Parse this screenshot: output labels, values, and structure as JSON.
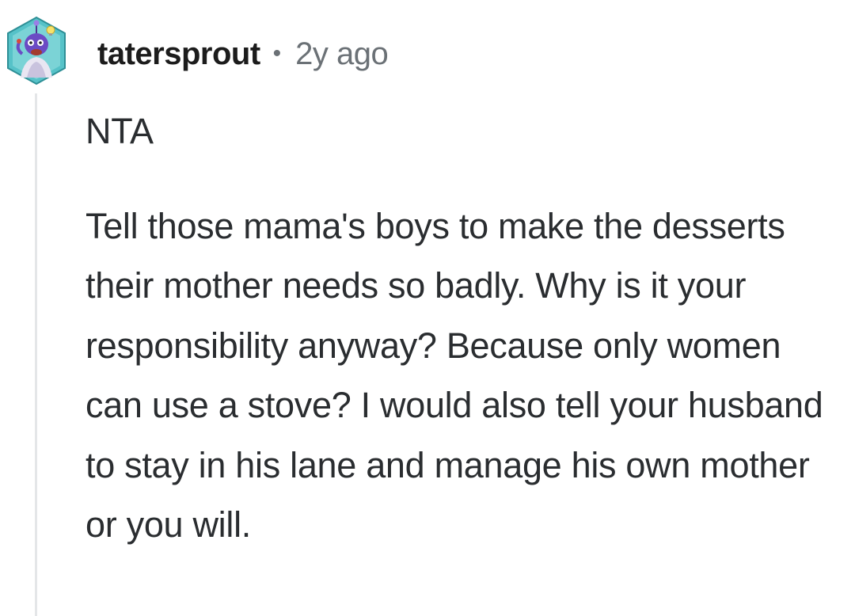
{
  "comment": {
    "username": "tatersprout",
    "separator": "•",
    "timestamp": "2y ago",
    "paragraphs": [
      "NTA",
      "Tell those mama's boys to make the desserts their mother needs so badly. Why is it your responsibility anyway? Because only women can use a stove? I would also tell your husband to stay in his lane and manage his own mother or you will."
    ]
  },
  "colors": {
    "username": "#1c1c1c",
    "meta": "#6b7176",
    "body": "#2a2d30",
    "thread_line": "#e4e6e8",
    "avatar_bg": "#56c2c8"
  },
  "avatar": {
    "icon": "snoo-avatar-icon"
  }
}
